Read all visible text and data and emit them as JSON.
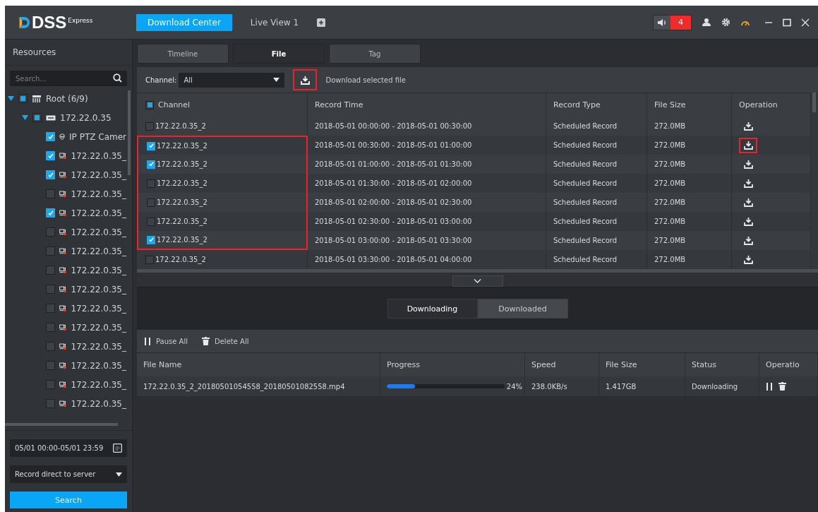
{
  "app": {
    "logo": "DSS",
    "logo_suffix": "Express"
  },
  "top_tabs": [
    {
      "label": "Download Center",
      "selected": true
    },
    {
      "label": "Live View 1",
      "selected": false
    }
  ],
  "alarm_count": "4",
  "sidebar": {
    "title": "Resources",
    "search_placeholder": "Search...",
    "tree": [
      {
        "label": "Root (6/9)",
        "kind": "network",
        "checked": false,
        "partial": true,
        "expanded": true,
        "children": [
          {
            "label": "172.22.0.35",
            "kind": "device",
            "checked": false,
            "partial": true,
            "expanded": true,
            "children": [
              {
                "label": "IP PTZ Camer",
                "kind": "ptz",
                "checked": true
              },
              {
                "label": "172.22.0.35_",
                "kind": "channel",
                "checked": true
              },
              {
                "label": "172.22.0.35_",
                "kind": "channel",
                "checked": true
              },
              {
                "label": "172.22.0.35_",
                "kind": "channel",
                "checked": false
              },
              {
                "label": "172.22.0.35_",
                "kind": "channel",
                "checked": true
              },
              {
                "label": "172.22.0.35_",
                "kind": "channel",
                "checked": false
              },
              {
                "label": "172.22.0.35_",
                "kind": "channel",
                "checked": false
              },
              {
                "label": "172.22.0.35_",
                "kind": "channel",
                "checked": false
              },
              {
                "label": "172.22.0.35_",
                "kind": "channel",
                "checked": false
              },
              {
                "label": "172.22.0.35_",
                "kind": "channel",
                "checked": false
              },
              {
                "label": "172.22.0.35_",
                "kind": "channel",
                "checked": false
              },
              {
                "label": "172.22.0.35_",
                "kind": "channel",
                "checked": false
              },
              {
                "label": "172.22.0.35_",
                "kind": "channel",
                "checked": false
              },
              {
                "label": "172.22.0.35_",
                "kind": "channel",
                "checked": false
              },
              {
                "label": "172.22.0.35_",
                "kind": "channel",
                "checked": false
              }
            ]
          }
        ]
      }
    ],
    "time_range": "05/01 00:00-05/01 23:59",
    "record_source": "Record direct to server",
    "search_button": "Search"
  },
  "view_tabs": [
    {
      "label": "Timeline",
      "selected": false
    },
    {
      "label": "File",
      "selected": true
    },
    {
      "label": "Tag",
      "selected": false
    }
  ],
  "toolbar": {
    "channel_label": "Channel:",
    "channel_value": "All",
    "download_label": "Download selected file",
    "download_outlined": true
  },
  "file_table": {
    "columns": [
      "Channel",
      "Record Time",
      "Record Type",
      "File Size",
      "Operation"
    ],
    "header_checked": false,
    "header_partial": true,
    "rows": [
      {
        "checked": false,
        "channel_outlined": false,
        "op_outlined": false,
        "cells": [
          "172.22.0.35_2",
          "2018-05-01 00:00:00 - 2018-05-01 00:30:00",
          "Scheduled Record",
          "272.0MB"
        ]
      },
      {
        "checked": true,
        "channel_outlined": true,
        "op_outlined": true,
        "cells": [
          "172.22.0.35_2",
          "2018-05-01 00:30:00 - 2018-05-01 01:00:00",
          "Scheduled Record",
          "272.0MB"
        ]
      },
      {
        "checked": true,
        "channel_outlined": true,
        "op_outlined": false,
        "cells": [
          "172.22.0.35_2",
          "2018-05-01 01:00:00 - 2018-05-01 01:30:00",
          "Scheduled Record",
          "272.0MB"
        ]
      },
      {
        "checked": false,
        "channel_outlined": true,
        "op_outlined": false,
        "cells": [
          "172.22.0.35_2",
          "2018-05-01 01:30:00 - 2018-05-01 02:00:00",
          "Scheduled Record",
          "272.0MB"
        ]
      },
      {
        "checked": false,
        "channel_outlined": true,
        "op_outlined": false,
        "cells": [
          "172.22.0.35_2",
          "2018-05-01 02:00:00 - 2018-05-01 02:30:00",
          "Scheduled Record",
          "272.0MB"
        ]
      },
      {
        "checked": false,
        "channel_outlined": true,
        "op_outlined": false,
        "cells": [
          "172.22.0.35_2",
          "2018-05-01 02:30:00 - 2018-05-01 03:00:00",
          "Scheduled Record",
          "272.0MB"
        ]
      },
      {
        "checked": true,
        "channel_outlined": true,
        "op_outlined": false,
        "cells": [
          "172.22.0.35_2",
          "2018-05-01 03:00:00 - 2018-05-01 03:30:00",
          "Scheduled Record",
          "272.0MB"
        ]
      },
      {
        "checked": false,
        "channel_outlined": false,
        "op_outlined": false,
        "cells": [
          "172.22.0.35_2",
          "2018-05-01 03:30:00 - 2018-05-01 04:00:00",
          "Scheduled Record",
          "272.0MB"
        ]
      }
    ]
  },
  "download_tabs": [
    {
      "label": "Downloading",
      "selected": true
    },
    {
      "label": "Downloaded",
      "selected": false
    }
  ],
  "download_actions": [
    "Pause All",
    "Delete All"
  ],
  "download_table": {
    "columns": [
      "File Name",
      "Progress",
      "Speed",
      "File Size",
      "Status",
      "Operatio"
    ],
    "rows": [
      {
        "file": "172.22.0.35_2_20180501054558_20180501082558.mp4",
        "level": 0.24,
        "percent": "24%",
        "speed": "238.0KB/s",
        "size": "1.417GB",
        "status": "Downloading"
      }
    ]
  }
}
